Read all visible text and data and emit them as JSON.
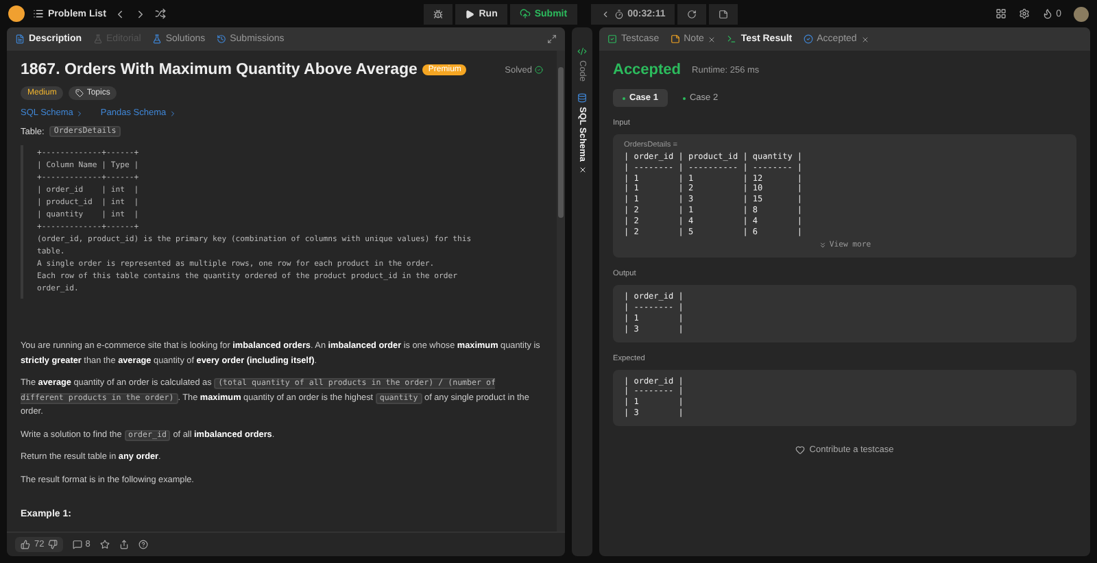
{
  "top_bar": {
    "problem_list": "Problem List",
    "run": "Run",
    "submit": "Submit",
    "timer": "00:32:11",
    "points": "0"
  },
  "left_tabs": [
    {
      "label": "Description",
      "selected": true,
      "disabled": false
    },
    {
      "label": "Editorial",
      "selected": false,
      "disabled": true
    },
    {
      "label": "Solutions",
      "selected": false,
      "disabled": false
    },
    {
      "label": "Submissions",
      "selected": false,
      "disabled": false
    }
  ],
  "problem": {
    "title": "1867. Orders With Maximum Quantity Above Average",
    "badge": "Premium",
    "status": "Solved",
    "tags": [
      "Medium",
      "Topics"
    ],
    "links": [
      "SQL Schema",
      "Pandas Schema"
    ],
    "table_label": "Table:",
    "table_name": "OrdersDetails",
    "schema_block": "+-------------+------+\n| Column Name | Type |\n+-------------+------+\n| order_id    | int  |\n| product_id  | int  |\n| quantity    | int  |\n+-------------+------+\n(order_id, product_id) is the primary key (combination of columns with unique values) for this\ntable.\nA single order is represented as multiple rows, one row for each product in the order.\nEach row of this table contains the quantity ordered of the product product_id in the order\norder_id.",
    "paragraphs": [
      [
        {
          "kind": "text",
          "text": "You are running an e-commerce site that is looking for **imbalanced orders**. An **imbalanced order** is one whose **maximum** quantity is **strictly greater** than the **average** quantity of **every order (including itself)**."
        }
      ],
      [
        {
          "kind": "text",
          "text": "The **average** quantity of an order is calculated as "
        },
        {
          "kind": "code",
          "text": "(total quantity of all products in the order) / (number of different products in the order)"
        },
        {
          "kind": "text",
          "text": ". The **maximum** quantity of an order is the highest "
        },
        {
          "kind": "code",
          "text": "quantity"
        },
        {
          "kind": "text",
          "text": " of any single product in the order."
        }
      ],
      [
        {
          "kind": "text",
          "text": "Write a solution to find the "
        },
        {
          "kind": "code",
          "text": "order_id"
        },
        {
          "kind": "text",
          "text": " of all **imbalanced orders**."
        }
      ],
      [
        {
          "kind": "text",
          "text": "Return the result table in **any order**."
        }
      ],
      [
        {
          "kind": "text",
          "text": "The result format is in the following example."
        }
      ]
    ],
    "example_heading": "Example 1:"
  },
  "footer": {
    "likes": "72",
    "comments": "8"
  },
  "side_tabs": [
    {
      "label": "Code",
      "selected": false
    },
    {
      "label": "SQL Schema",
      "selected": true
    }
  ],
  "right_tabs": [
    {
      "label": "Testcase",
      "selected": false,
      "closable": false
    },
    {
      "label": "Note",
      "selected": false,
      "closable": true
    },
    {
      "label": "Test Result",
      "selected": true,
      "closable": false
    },
    {
      "label": "Accepted",
      "selected": false,
      "closable": true
    }
  ],
  "result": {
    "status": "Accepted",
    "runtime": "Runtime: 256 ms",
    "cases": [
      {
        "label": "Case 1",
        "selected": true
      },
      {
        "label": "Case 2",
        "selected": false
      }
    ],
    "input_label": "Input",
    "input_var": "OrdersDetails =",
    "input_block": "| order_id | product_id | quantity |\n| -------- | ---------- | -------- |\n| 1        | 1          | 12       |\n| 1        | 2          | 10       |\n| 1        | 3          | 15       |\n| 2        | 1          | 8        |\n| 2        | 4          | 4        |\n| 2        | 5          | 6        |",
    "view_more": "View more",
    "output_label": "Output",
    "output_block": "| order_id |\n| -------- |\n| 1        |\n| 3        |",
    "expected_label": "Expected",
    "expected_block": "| order_id |\n| -------- |\n| 1        |\n| 3        |",
    "contribute": "Contribute a testcase"
  }
}
